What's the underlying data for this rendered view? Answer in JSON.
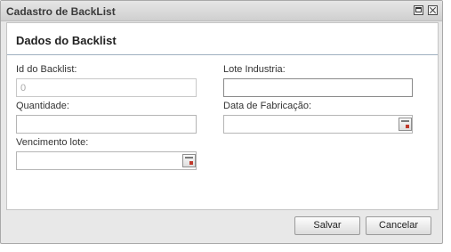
{
  "window": {
    "title": "Cadastro de BackList",
    "maximize_icon": "maximize-icon",
    "close_icon": "close-icon"
  },
  "panel": {
    "title": "Dados do Backlist"
  },
  "fields": {
    "id_backlist": {
      "label": "Id do Backlist:",
      "value": "0"
    },
    "lote_industria": {
      "label": "Lote Industria:",
      "value": ""
    },
    "quantidade": {
      "label": "Quantidade:",
      "value": ""
    },
    "data_fabricacao": {
      "label": "Data de Fabricação:",
      "value": "",
      "icon": "calendar-icon"
    },
    "vencimento_lote": {
      "label": "Vencimento lote:",
      "value": "",
      "icon": "calendar-icon"
    }
  },
  "buttons": {
    "save": "Salvar",
    "cancel": "Cancelar"
  }
}
